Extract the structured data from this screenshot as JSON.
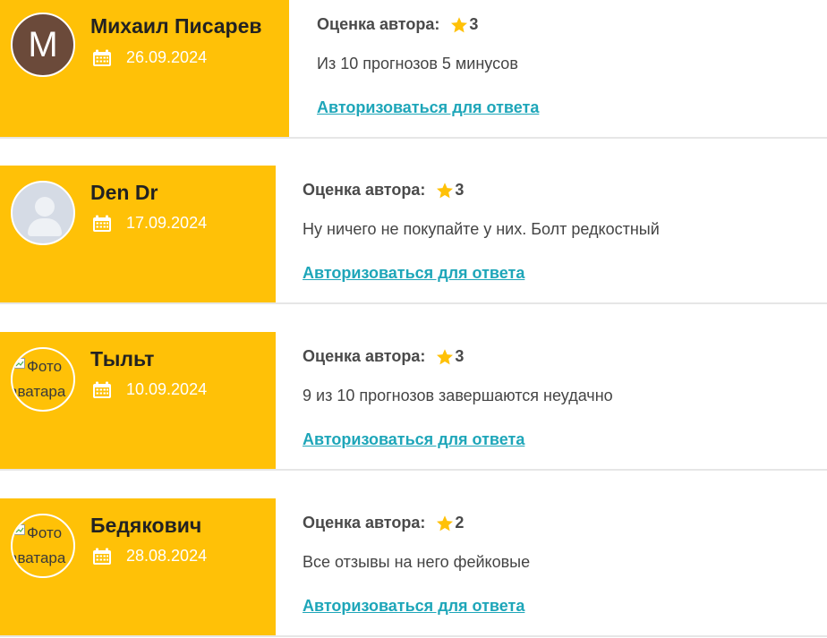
{
  "reviews": [
    {
      "avatar": {
        "kind": "letter",
        "letter": "М",
        "bg": "#6b4a3a"
      },
      "name": "Михаил Писарев",
      "date": "26.09.2024",
      "rating_label": "Оценка автора:",
      "rating": "3",
      "text": "Из 10 прогнозов 5 минусов",
      "reply_link": "Авторизоваться для ответа"
    },
    {
      "avatar": {
        "kind": "placeholder"
      },
      "name": "Den Dr",
      "date": "17.09.2024",
      "rating_label": "Оценка автора:",
      "rating": "3",
      "text": "Ну ничего не покупайте у них. Болт редкостный",
      "reply_link": "Авторизоваться для ответа"
    },
    {
      "avatar": {
        "kind": "broken",
        "alt_line1": "Фото",
        "alt_line2": "аватара"
      },
      "name": "Тыльт",
      "date": "10.09.2024",
      "rating_label": "Оценка автора:",
      "rating": "3",
      "text": "9 из 10 прогнозов завершаются неудачно",
      "reply_link": "Авторизоваться для ответа"
    },
    {
      "avatar": {
        "kind": "broken",
        "alt_line1": "Фото",
        "alt_line2": "аватара"
      },
      "name": "Бедякович",
      "date": "28.08.2024",
      "rating_label": "Оценка автора:",
      "rating": "2",
      "text": "Все отзывы на него фейковые",
      "reply_link": "Авторизоваться для ответа"
    }
  ],
  "colors": {
    "author_panel": "#ffc107",
    "link": "#1ea6b9",
    "star": "#ffc107",
    "divider": "#e6e6e6"
  }
}
